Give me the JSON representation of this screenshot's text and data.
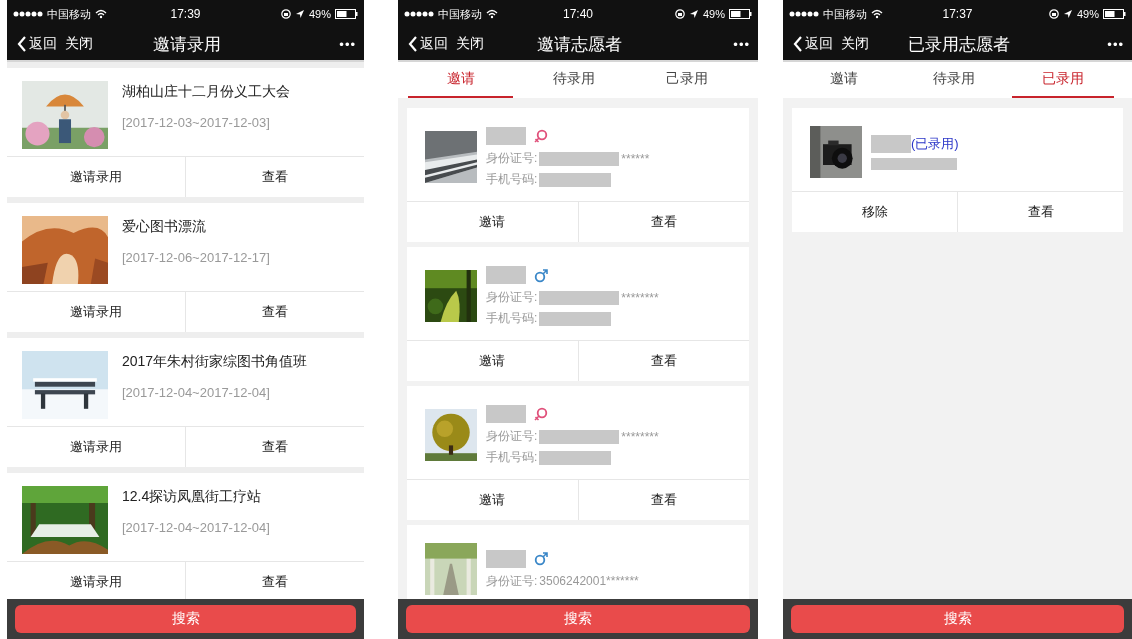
{
  "phones": [
    {
      "kind": "activities",
      "status": {
        "carrier": "中国移动",
        "time": "17:39",
        "battery": "49%"
      },
      "nav": {
        "back": "返回",
        "close": "关闭",
        "title": "邀请录用",
        "more": "•••"
      },
      "activities": [
        {
          "title": "湖柏山庄十二月份义工大会",
          "dates": "[2017-12-03~2017-12-03]",
          "actions": [
            "邀请录用",
            "查看"
          ]
        },
        {
          "title": "爱心图书漂流",
          "dates": "[2017-12-06~2017-12-17]",
          "actions": [
            "邀请录用",
            "查看"
          ]
        },
        {
          "title": "2017年朱村街家综图书角值班",
          "dates": "[2017-12-04~2017-12-04]",
          "actions": [
            "邀请录用",
            "查看"
          ]
        },
        {
          "title": "12.4探访凤凰街工疗站",
          "dates": "[2017-12-04~2017-12-04]",
          "actions": [
            "邀请录用",
            "查看"
          ]
        }
      ],
      "search_button": "搜索"
    },
    {
      "kind": "volunteers",
      "status": {
        "carrier": "中国移动",
        "time": "17:40",
        "battery": "49%"
      },
      "nav": {
        "back": "返回",
        "close": "关闭",
        "title": "邀请志愿者",
        "more": "•••"
      },
      "tabs": [
        {
          "label": "邀请",
          "selected": true
        },
        {
          "label": "待录用",
          "selected": false
        },
        {
          "label": "己录用",
          "selected": false
        }
      ],
      "volunteers": [
        {
          "female": true,
          "id_label": "身份证号:",
          "id_masked": true,
          "id_value": "******",
          "phone_label": "手机号码:",
          "actions": [
            "邀请",
            "查看"
          ]
        },
        {
          "female": false,
          "id_label": "身份证号:",
          "id_masked": true,
          "id_value": "********",
          "phone_label": "手机号码:",
          "actions": [
            "邀请",
            "查看"
          ]
        },
        {
          "female": true,
          "id_label": "身份证号:",
          "id_masked": true,
          "id_value": "********",
          "phone_label": "手机号码:",
          "actions": [
            "邀请",
            "查看"
          ]
        },
        {
          "female": false,
          "id_label": "身份证号:",
          "id_masked": false,
          "id_value": "3506242001*******"
        }
      ],
      "search_button": "搜索"
    },
    {
      "kind": "volunteers",
      "status": {
        "carrier": "中国移动",
        "time": "17:37",
        "battery": "49%"
      },
      "nav": {
        "back": "返回",
        "close": "关闭",
        "title": "已录用志愿者",
        "more": "•••"
      },
      "tabs": [
        {
          "label": "邀请",
          "selected": false
        },
        {
          "label": "待录用",
          "selected": false
        },
        {
          "label": "已录用",
          "selected": true
        }
      ],
      "volunteers": [
        {
          "tag": "(已录用)",
          "detail_masked": true,
          "actions": [
            "移除",
            "查看"
          ]
        }
      ],
      "search_button": "搜索"
    }
  ]
}
